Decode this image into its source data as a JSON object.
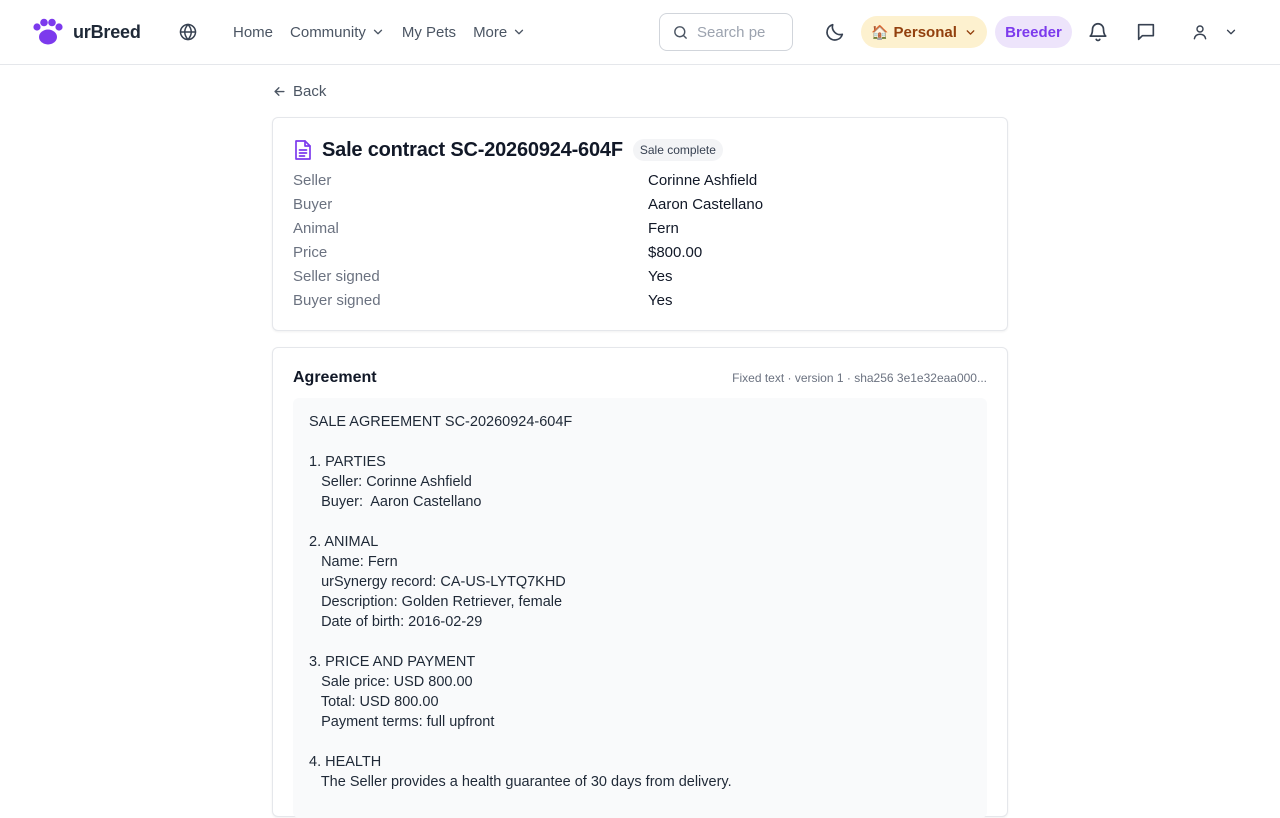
{
  "header": {
    "brand": "urBreed",
    "nav": [
      {
        "label": "Home"
      },
      {
        "label": "Community"
      },
      {
        "label": "My Pets"
      },
      {
        "label": "More"
      }
    ],
    "search_placeholder": "Search pe",
    "context_pill": "Personal",
    "role_pill": "Breeder",
    "colors": {
      "brand_purple": "#7c3aed",
      "personal_bg": "#fdf1cf",
      "personal_fg": "#92400e",
      "breeder_bg": "#ede4fb"
    }
  },
  "back": {
    "label": "Back"
  },
  "contract": {
    "title": "Sale contract SC-20260924-604F",
    "status": "Sale complete",
    "fields": [
      {
        "label": "Seller",
        "value": "Corinne Ashfield"
      },
      {
        "label": "Buyer",
        "value": "Aaron Castellano"
      },
      {
        "label": "Animal",
        "value": "Fern"
      },
      {
        "label": "Price",
        "value": "$800.00"
      },
      {
        "label": "Seller signed",
        "value": "Yes"
      },
      {
        "label": "Buyer signed",
        "value": "Yes"
      }
    ]
  },
  "agreement": {
    "heading": "Agreement",
    "meta": "Fixed text · version 1 · sha256 3e1e32eaa000...",
    "lines": [
      "SALE AGREEMENT SC-20260924-604F",
      "",
      "1. PARTIES",
      "   Seller: Corinne Ashfield",
      "   Buyer:  Aaron Castellano",
      "",
      "2. ANIMAL",
      "   Name: Fern",
      "   urSynergy record: CA-US-LYTQ7KHD",
      "   Description: Golden Retriever, female",
      "   Date of birth: 2016-02-29",
      "",
      "3. PRICE AND PAYMENT",
      "   Sale price: USD 800.00",
      "   Total: USD 800.00",
      "   Payment terms: full upfront",
      "",
      "4. HEALTH",
      "   The Seller provides a health guarantee of 30 days from delivery."
    ]
  },
  "icons": [
    "paw-logo-icon",
    "globe-icon",
    "chevron-down-icon",
    "search-icon",
    "moon-icon",
    "house-icon",
    "bell-icon",
    "chat-icon",
    "user-icon",
    "arrow-left-icon",
    "document-icon"
  ]
}
